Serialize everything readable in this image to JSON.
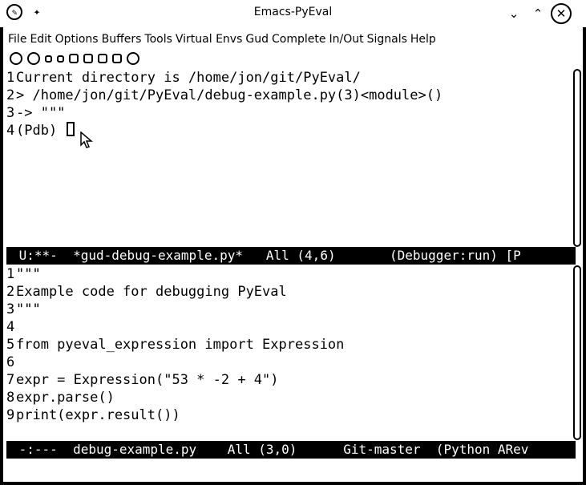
{
  "window": {
    "title": "Emacs-PyEval"
  },
  "menubar": {
    "items": [
      "File",
      "Edit",
      "Options",
      "Buffers",
      "Tools",
      "Virtual Envs",
      "Gud",
      "Complete",
      "In/Out",
      "Signals",
      "Help"
    ]
  },
  "toolbar": {
    "icons": [
      "stop-icon",
      "go-icon",
      "next-icon",
      "step-icon",
      "up-icon",
      "down-icon",
      "finish-icon",
      "print-icon",
      "watch-icon"
    ]
  },
  "debugger_pane": {
    "lines": [
      {
        "num": "1",
        "text": "Current directory is /home/jon/git/PyEval/"
      },
      {
        "num": "2",
        "text": "> /home/jon/git/PyEval/debug-example.py(3)<module>()"
      },
      {
        "num": "3",
        "text": "-> \"\"\""
      },
      {
        "num": "4",
        "text": "(Pdb) "
      }
    ]
  },
  "modeline_top": {
    "text": " U:**-  *gud-debug-example.py*   All (4,6)       (Debugger:run) [P"
  },
  "source_pane": {
    "lines": [
      {
        "num": "1",
        "text": "\"\"\""
      },
      {
        "num": "2",
        "text": "Example code for debugging PyEval"
      },
      {
        "num": "3",
        "text": "\"\"\""
      },
      {
        "num": "4",
        "text": ""
      },
      {
        "num": "5",
        "text": "from pyeval_expression import Expression"
      },
      {
        "num": "6",
        "text": ""
      },
      {
        "num": "7",
        "text": "expr = Expression(\"53 * -2 + 4\")"
      },
      {
        "num": "8",
        "text": "expr.parse()"
      },
      {
        "num": "9",
        "text": "print(expr.result())"
      }
    ]
  },
  "modeline_bottom": {
    "text": " -:---  debug-example.py    All (3,0)      Git-master  (Python ARev"
  }
}
